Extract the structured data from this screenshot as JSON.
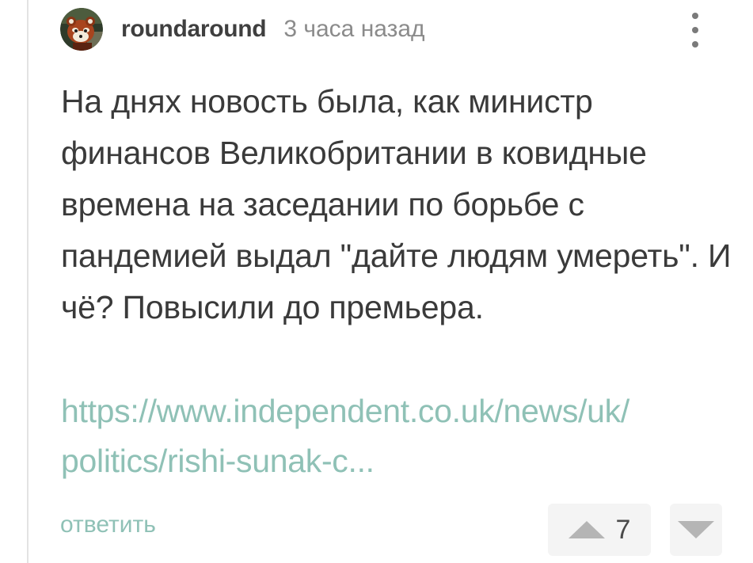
{
  "comment": {
    "author": "roundaround",
    "time": "3 часа назад",
    "avatar_icon": "red-panda-avatar",
    "text": "На днях новость была, как министр финансов Великобритании в ковидные времена на заседании по борьбе с пандемией выдал \"дайте людям умереть\". И чё? Повысили до премьера.",
    "link_lines": [
      "https://www.independent.co.uk/news/uk/",
      "politics/rishi-sunak-c..."
    ],
    "reply_label": "ответить",
    "score": "7"
  },
  "colors": {
    "accent": "#8fc1b6",
    "text": "#3a3a3a",
    "muted": "#8b8b8b",
    "button_bg": "#f4f4f4",
    "arrow": "#b5b5b5"
  }
}
